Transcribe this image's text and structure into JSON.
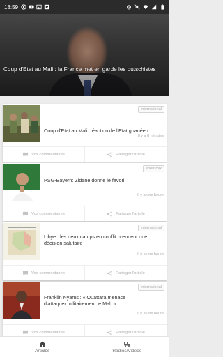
{
  "status_bar": {
    "time": "18:59",
    "left_icons": [
      "whatsapp-icon",
      "youtube-icon",
      "gallery-icon",
      "flipboard-icon"
    ],
    "right_icons": [
      "alarm-icon",
      "mute-icon",
      "wifi-icon",
      "signal-icon",
      "battery-icon"
    ]
  },
  "hero": {
    "title": "Coup d'Etat au Mali : la France met en garde les putschistes",
    "slide_count": 13,
    "active_slide": 5
  },
  "cards": [
    {
      "title": "Coup d'Etat au Mali: réaction de l'Etat ghanéen",
      "tag": "international",
      "time_ago": "Il y a 8 minutes",
      "comments_label": "Vos commentaires",
      "share_label": "Partager l'article"
    },
    {
      "title": "PSG-Bayern: Zidane donne le favori",
      "tag": "sport-mix",
      "time_ago": "Il y a une heure",
      "comments_label": "Vos commentaires",
      "share_label": "Partager l'article"
    },
    {
      "title": "Libye : les deux camps en conflit prennent une décision salutaire",
      "tag": "international",
      "time_ago": "Il y a une heure",
      "comments_label": "Vos commentaires",
      "share_label": "Partager l'article"
    },
    {
      "title": "Franklin Nyamsi: « Ouattara menace d'attaquer militairement le Mali »",
      "tag": "international",
      "time_ago": "Il y a une heure",
      "comments_label": "Vos commentaires",
      "share_label": "Partager l'article"
    }
  ],
  "bottom_nav": {
    "articles_label": "Articles",
    "videos_label": "Radios/Videos"
  },
  "colors": {
    "status_bar": "#2b2b2b",
    "card_background": "#ffffff",
    "feed_background": "#ececec",
    "muted_text": "#b0b0b0"
  }
}
